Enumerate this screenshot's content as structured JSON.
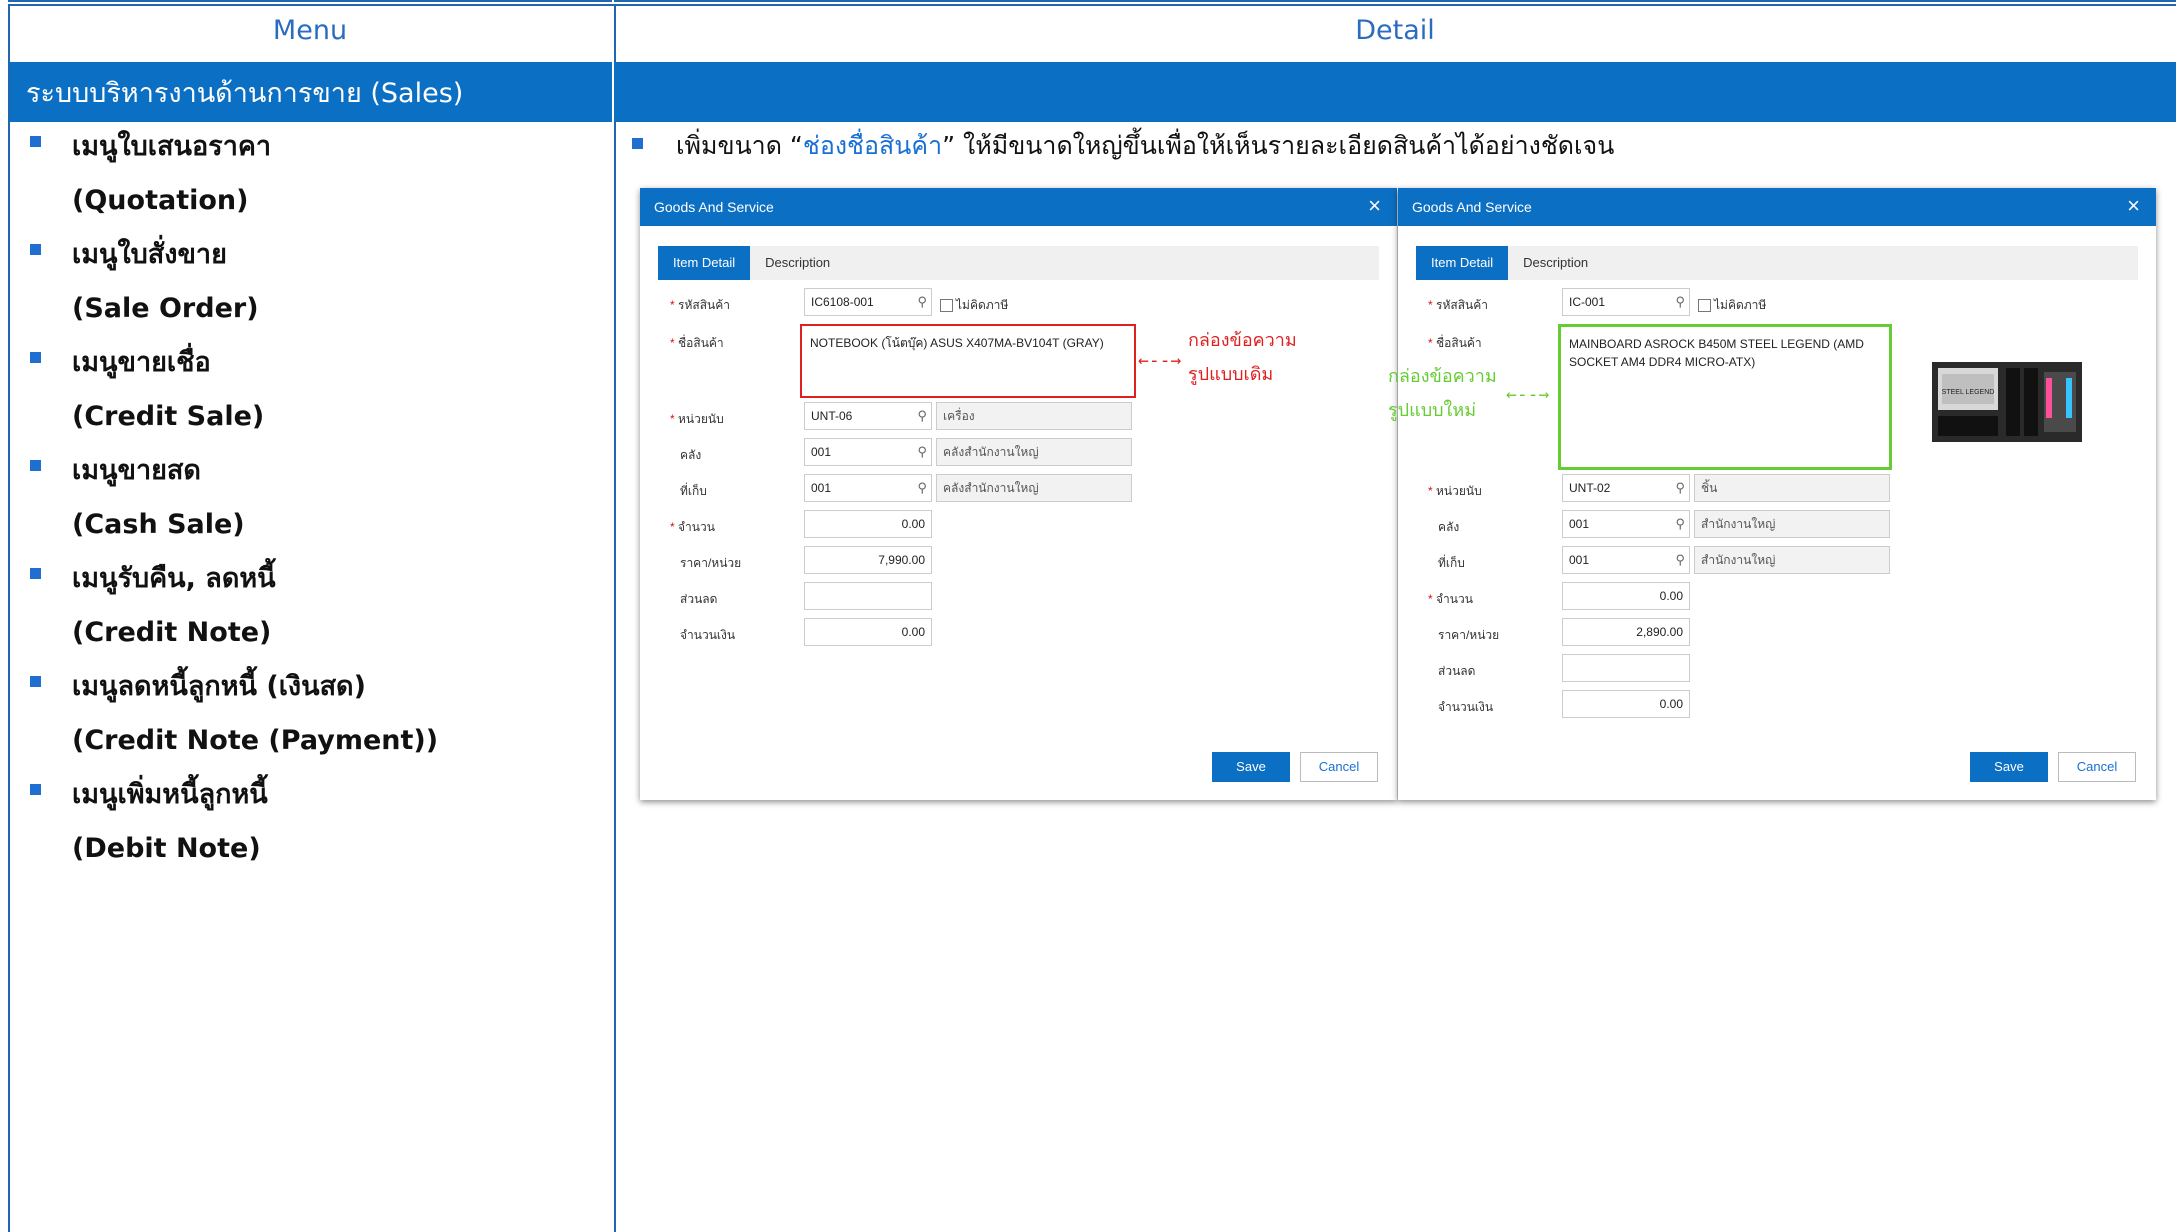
{
  "headers": {
    "menu": "Menu",
    "detail": "Detail"
  },
  "section": {
    "title": "ระบบบริหารงานด้านการขาย (Sales)"
  },
  "menu_items": [
    {
      "th": "เมนูใบเสนอราคา",
      "en": "(Quotation)"
    },
    {
      "th": "เมนูใบสั่งขาย",
      "en": "(Sale Order)"
    },
    {
      "th": "เมนูขายเชื่อ",
      "en": "(Credit Sale)"
    },
    {
      "th": "เมนูขายสด",
      "en": "(Cash Sale)"
    },
    {
      "th": "เมนูรับคืน, ลดหนี้",
      "en": "(Credit Note)"
    },
    {
      "th": "เมนูลดหนี้ลูกหนี้ (เงินสด)",
      "en": "(Credit Note (Payment))"
    },
    {
      "th": "เมนูเพิ่มหนี้ลูกหนี้",
      "en": "(Debit Note)"
    }
  ],
  "detail": {
    "prefix": "เพิ่มขนาด “",
    "highlight": "ช่องชื่อสินค้า",
    "suffix": "” ให้มีขนาดใหญ่ขึ้นเพื่อให้เห็นรายละเอียดสินค้าได้อย่างชัดเจน"
  },
  "colors": {
    "brand": "#0b6fc4",
    "old_box": "#e02020",
    "new_box": "#66cc33",
    "bullet": "#1f6fd0"
  },
  "labels": {
    "product_code": "รหัสสินค้า",
    "product_name": "ชื่อสินค้า",
    "unit": "หน่วยนับ",
    "warehouse": "คลัง",
    "location": "ที่เก็บ",
    "quantity": "จำนวน",
    "price_unit": "ราคา/หน่วย",
    "discount": "ส่วนลด",
    "amount": "จำนวนเงิน",
    "no_tax": "ไม่คิดภาษี",
    "required_mark": "*"
  },
  "dialog_old": {
    "title": "Goods And Service",
    "close_icon": "×",
    "tabs": [
      "Item Detail",
      "Description"
    ],
    "product_code": "IC6108-001",
    "product_name": "NOTEBOOK (โน้ตบุ๊ค) ASUS X407MA-BV104T (GRAY)",
    "unit": "UNT-06",
    "unit_name": "เครื่อง",
    "warehouse": "001",
    "warehouse_name": "คลังสำนักงานใหญ่",
    "location": "001",
    "location_name": "คลังสำนักงานใหญ่",
    "quantity": "0.00",
    "price_unit": "7,990.00",
    "discount": "",
    "amount": "0.00",
    "save": "Save",
    "cancel": "Cancel",
    "annotation_line1": "กล่องข้อความ",
    "annotation_line2": "รูปแบบเดิม"
  },
  "dialog_new": {
    "title": "Goods And Service",
    "close_icon": "×",
    "tabs": [
      "Item Detail",
      "Description"
    ],
    "product_code": "IC-001",
    "product_name": "MAINBOARD ASROCK B450M STEEL LEGEND (AMD SOCKET AM4 DDR4 MICRO-ATX)",
    "unit": "UNT-02",
    "unit_name": "ชิ้น",
    "warehouse": "001",
    "warehouse_name": "สำนักงานใหญ่",
    "location": "001",
    "location_name": "สำนักงานใหญ่",
    "quantity": "0.00",
    "price_unit": "2,890.00",
    "discount": "",
    "amount": "0.00",
    "save": "Save",
    "cancel": "Cancel",
    "annotation_line1": "กล่องข้อความ",
    "annotation_line2": "รูปแบบใหม่",
    "product_image": "mainboard-photo",
    "image_text": "STEEL LEGEND"
  }
}
